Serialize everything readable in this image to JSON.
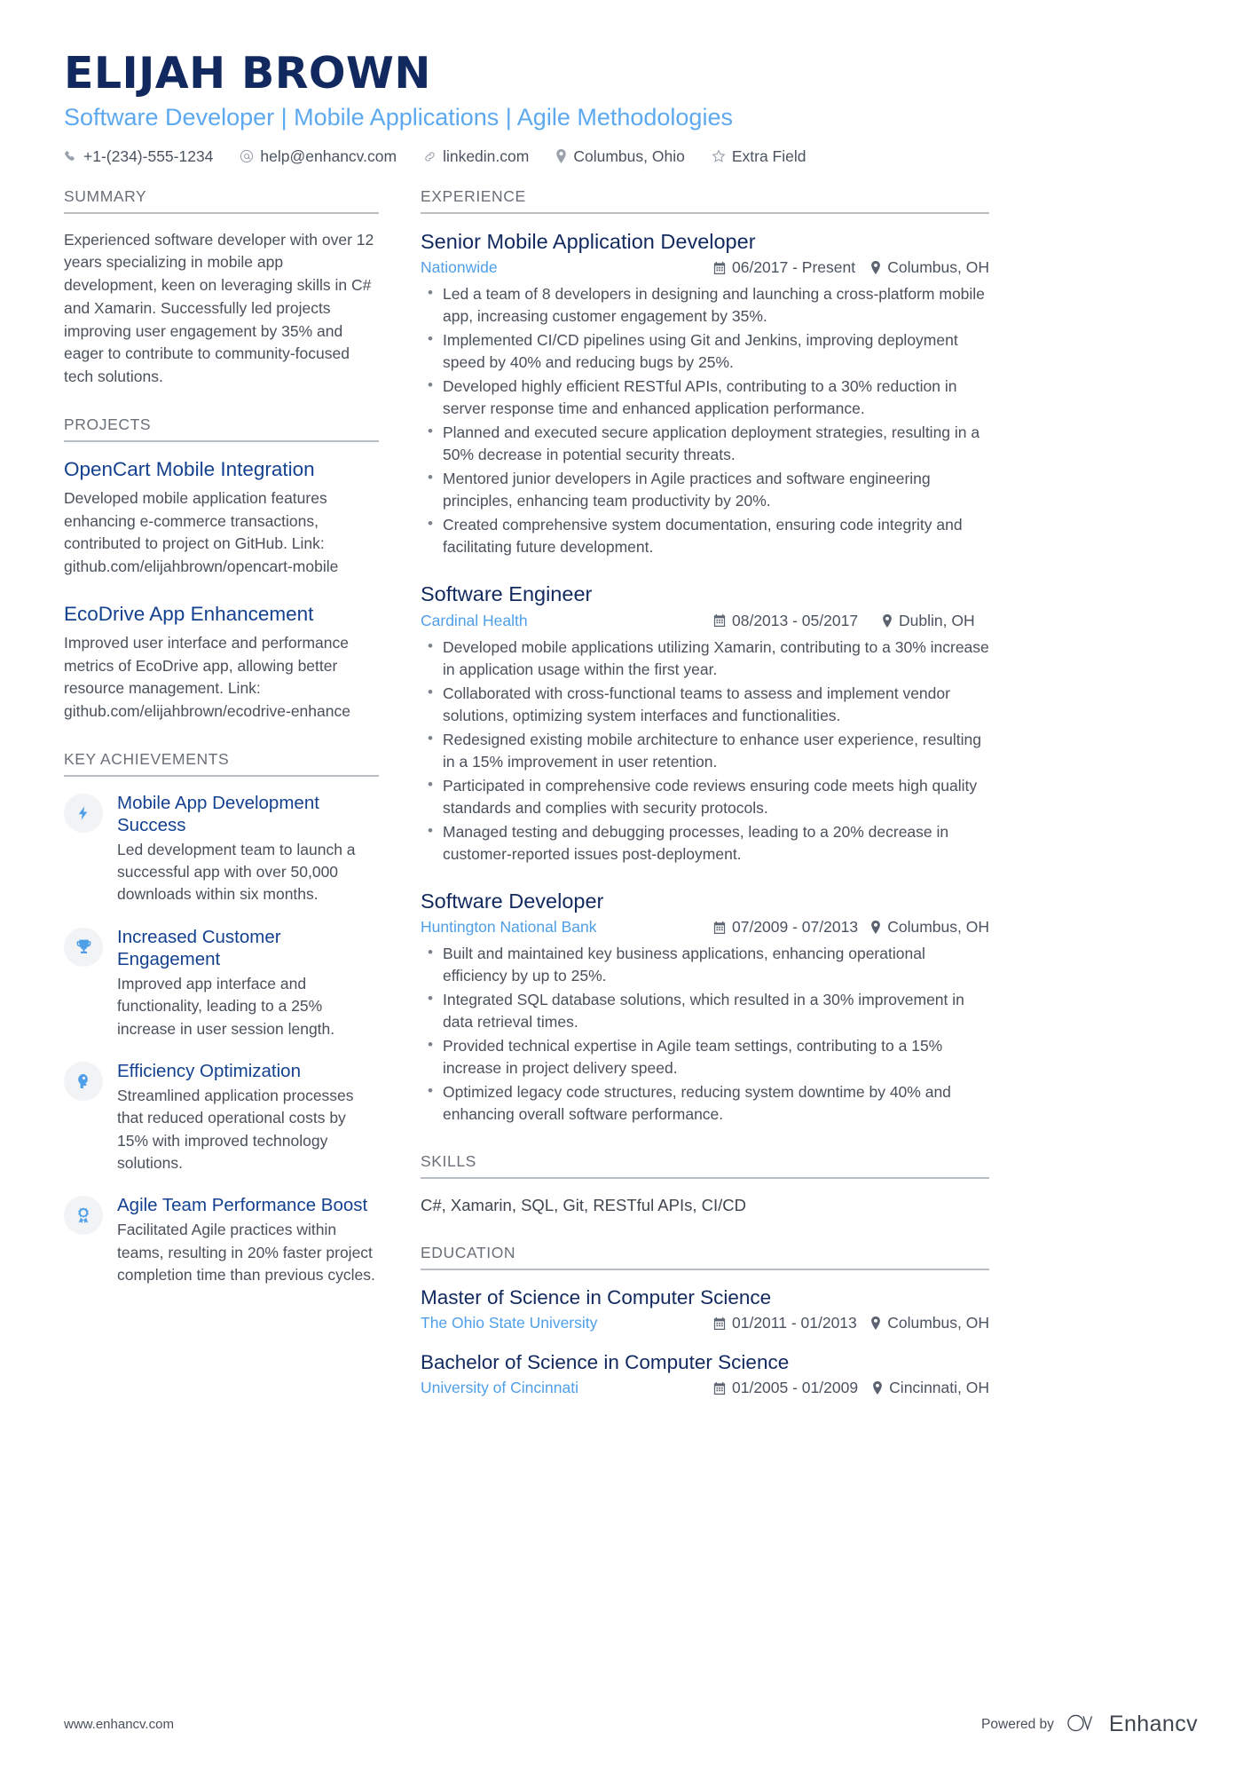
{
  "header": {
    "name": "ELIJAH BROWN",
    "headline": "Software Developer | Mobile Applications | Agile Methodologies",
    "contacts": [
      {
        "icon": "phone-icon",
        "text": "+1-(234)-555-1234"
      },
      {
        "icon": "email-icon",
        "text": "help@enhancv.com"
      },
      {
        "icon": "link-icon",
        "text": "linkedin.com"
      },
      {
        "icon": "location-icon",
        "text": "Columbus, Ohio"
      },
      {
        "icon": "star-icon",
        "text": "Extra Field"
      }
    ]
  },
  "left": {
    "summary": {
      "title": "SUMMARY",
      "text": "Experienced software developer with over 12 years specializing in mobile app development, keen on leveraging skills in C# and Xamarin. Successfully led projects improving user engagement by 35% and eager to contribute to community-focused tech solutions."
    },
    "projects": {
      "title": "PROJECTS",
      "items": [
        {
          "name": "OpenCart Mobile Integration",
          "description": "Developed mobile application features enhancing e-commerce transactions, contributed to project on GitHub. Link: github.com/elijahbrown/opencart-mobile"
        },
        {
          "name": "EcoDrive App Enhancement",
          "description": "Improved user interface and performance metrics of EcoDrive app, allowing better resource management. Link: github.com/elijahbrown/ecodrive-enhance"
        }
      ]
    },
    "achievements": {
      "title": "KEY ACHIEVEMENTS",
      "items": [
        {
          "icon": "lightning-bolt-icon",
          "title": "Mobile App Development Success",
          "description": "Led development team to launch a successful app with over 50,000 downloads within six months."
        },
        {
          "icon": "trophy-icon",
          "title": "Increased Customer Engagement",
          "description": "Improved app interface and functionality, leading to a 25% increase in user session length."
        },
        {
          "icon": "head-thinking-icon",
          "title": "Efficiency Optimization",
          "description": "Streamlined application processes that reduced operational costs by 15% with improved technology solutions."
        },
        {
          "icon": "award-ribbon-icon",
          "title": "Agile Team Performance Boost",
          "description": "Facilitated Agile practices within teams, resulting in 20% faster project completion time than previous cycles."
        }
      ]
    }
  },
  "right": {
    "experience": {
      "title": "EXPERIENCE",
      "jobs": [
        {
          "role": "Senior Mobile Application Developer",
          "company": "Nationwide",
          "dates": "06/2017 - Present",
          "location": "Columbus, OH",
          "bullets": [
            "Led a team of 8 developers in designing and launching a cross-platform mobile app, increasing customer engagement by 35%.",
            "Implemented CI/CD pipelines using Git and Jenkins, improving deployment speed by 40% and reducing bugs by 25%.",
            "Developed highly efficient RESTful APIs, contributing to a 30% reduction in server response time and enhanced application performance.",
            "Planned and executed secure application deployment strategies, resulting in a 50% decrease in potential security threats.",
            "Mentored junior developers in Agile practices and software engineering principles, enhancing team productivity by 20%.",
            "Created comprehensive system documentation, ensuring code integrity and facilitating future development."
          ]
        },
        {
          "role": "Software Engineer",
          "company": "Cardinal Health",
          "dates": "08/2013 - 05/2017",
          "location": "Dublin, OH",
          "bullets": [
            "Developed mobile applications utilizing Xamarin, contributing to a 30% increase in application usage within the first year.",
            "Collaborated with cross-functional teams to assess and implement vendor solutions, optimizing system interfaces and functionalities.",
            "Redesigned existing mobile architecture to enhance user experience, resulting in a 15% improvement in user retention.",
            "Participated in comprehensive code reviews ensuring code meets high quality standards and complies with security protocols.",
            "Managed testing and debugging processes, leading to a 20% decrease in customer-reported issues post-deployment."
          ]
        },
        {
          "role": "Software Developer",
          "company": "Huntington National Bank",
          "dates": "07/2009 - 07/2013",
          "location": "Columbus, OH",
          "bullets": [
            "Built and maintained key business applications, enhancing operational efficiency by up to 25%.",
            "Integrated SQL database solutions, which resulted in a 30% improvement in data retrieval times.",
            "Provided technical expertise in Agile team settings, contributing to a 15% increase in project delivery speed.",
            "Optimized legacy code structures, reducing system downtime by 40% and enhancing overall software performance."
          ]
        }
      ]
    },
    "skills": {
      "title": "SKILLS",
      "text": "C#, Xamarin, SQL, Git, RESTful APIs, CI/CD"
    },
    "education": {
      "title": "EDUCATION",
      "items": [
        {
          "degree": "Master of Science in Computer Science",
          "school": "The Ohio State University",
          "dates": "01/2011 - 01/2013",
          "location": "Columbus, OH"
        },
        {
          "degree": "Bachelor of Science in Computer Science",
          "school": "University of Cincinnati",
          "dates": "01/2005 - 01/2009",
          "location": "Cincinnati, OH"
        }
      ]
    }
  },
  "footer": {
    "website": "www.enhancv.com",
    "powered_by": "Powered by",
    "brand": "Enhancv"
  },
  "colors": {
    "navy": "#11295e",
    "link_blue": "#14418f",
    "light_blue": "#5da9ef",
    "company_blue": "#4f9fe8",
    "body_gray": "#4a515b",
    "rule_gray": "#b9bdc4"
  }
}
